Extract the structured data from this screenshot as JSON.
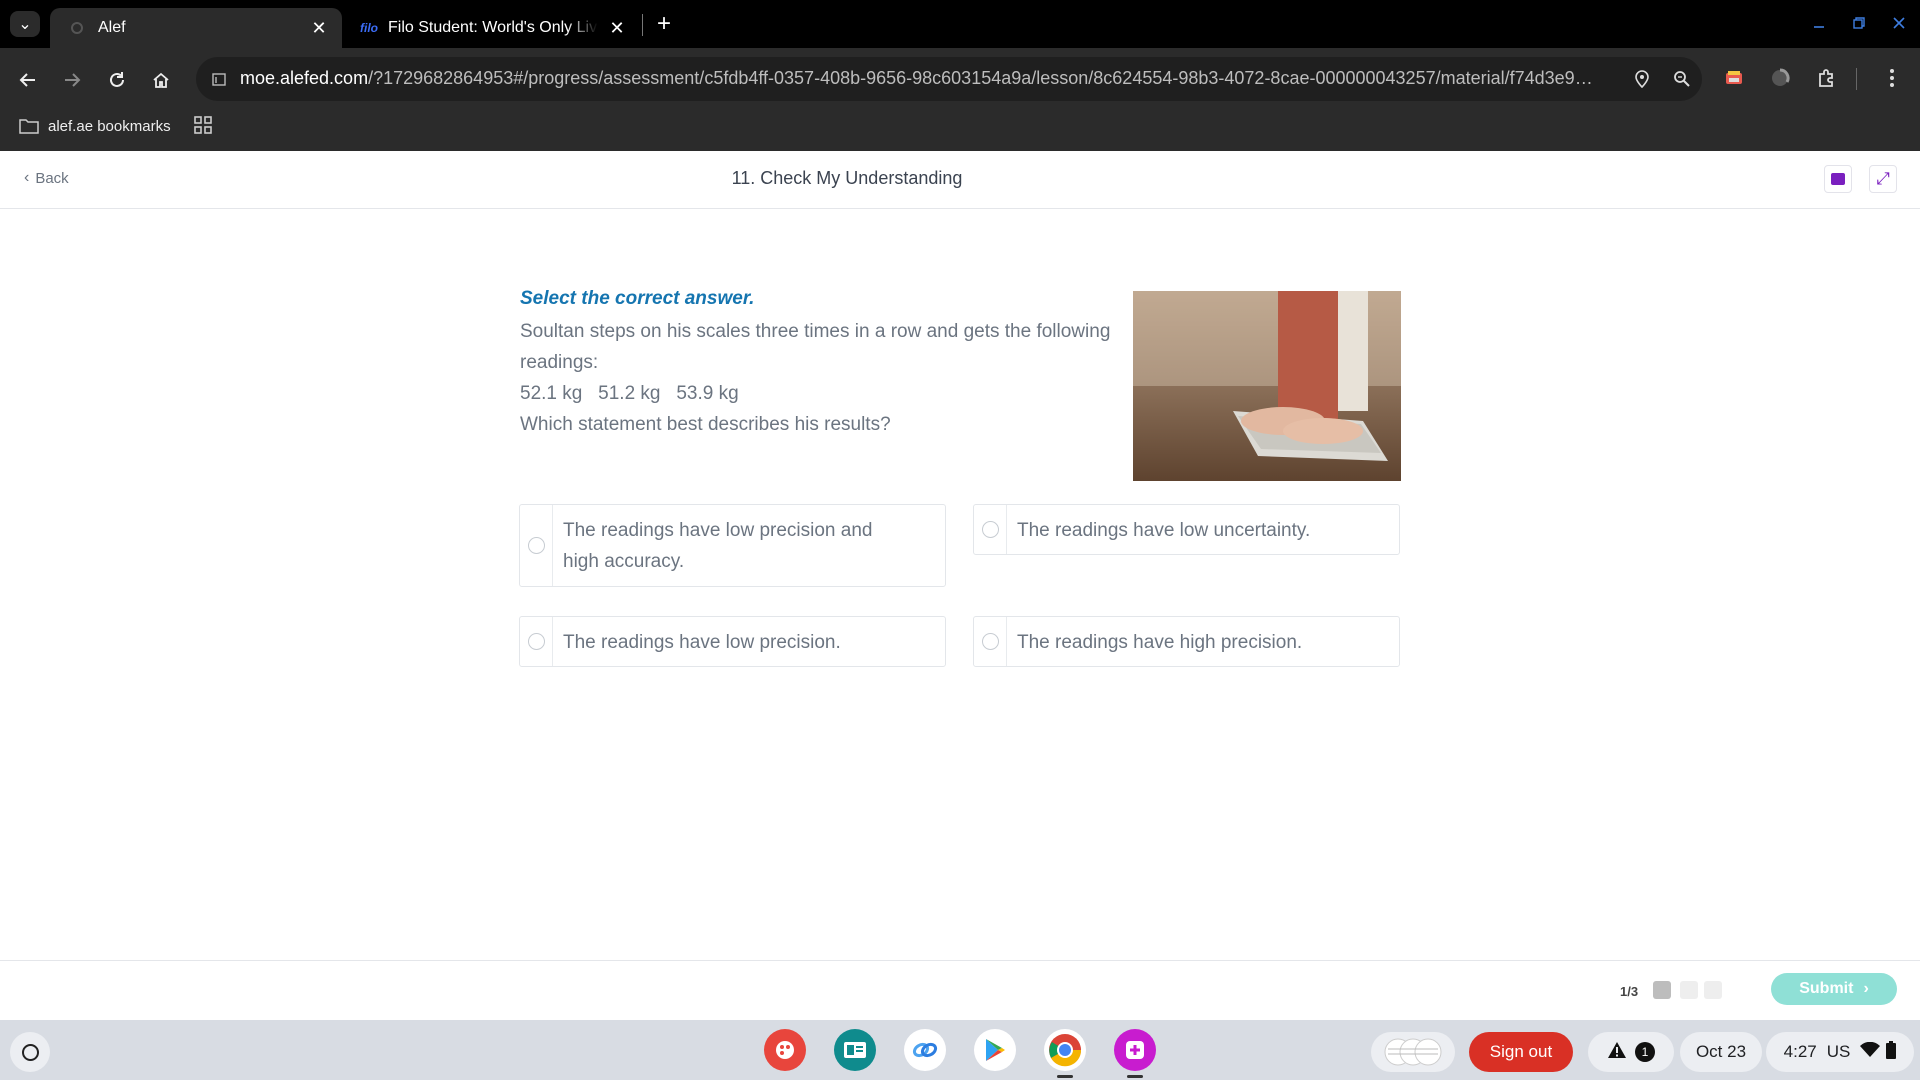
{
  "browser": {
    "tabs": [
      {
        "title": "Alef",
        "active": true
      },
      {
        "title": "Filo Student: World's Only Live Instant Tutoring Platform",
        "favicon_text": "filo",
        "active": false
      }
    ],
    "url_host": "moe.alefed.com",
    "url_rest": "/?1729682864953#/progress/assessment/c5fdb4ff-0357-408b-9656-98c603154a9a/lesson/8c624554-98b3-4072-8cae-000000043257/material/f74d3e9a-a...",
    "bookmark_label": "alef.ae bookmarks"
  },
  "page": {
    "back_label": "Back",
    "title": "11. Check My Understanding",
    "question": {
      "instruction": "Select the correct answer.",
      "line1": "Soultan steps on his scales three times in a row and gets the following",
      "line2": "readings:",
      "line3": "52.1 kg   51.2 kg   53.9 kg",
      "line4": "Which statement best describes his results?"
    },
    "options": [
      {
        "line1": "The readings have low precision and",
        "line2": "high accuracy."
      },
      {
        "line1": "The readings have low uncertainty."
      },
      {
        "line1": "The readings have low precision."
      },
      {
        "line1": "The readings have high precision."
      }
    ],
    "progress_text": "1/3",
    "submit_label": "Submit"
  },
  "shelf": {
    "sign_out_label": "Sign out",
    "notification_count": "1",
    "date": "Oct 23",
    "time": "4:27",
    "locale": "US"
  },
  "colors": {
    "instruction": "#1575b0",
    "body_text": "#6b7480",
    "submit_bg": "#8fe0d6",
    "accent": "#7a1fbf",
    "sign_out": "#d93025"
  }
}
